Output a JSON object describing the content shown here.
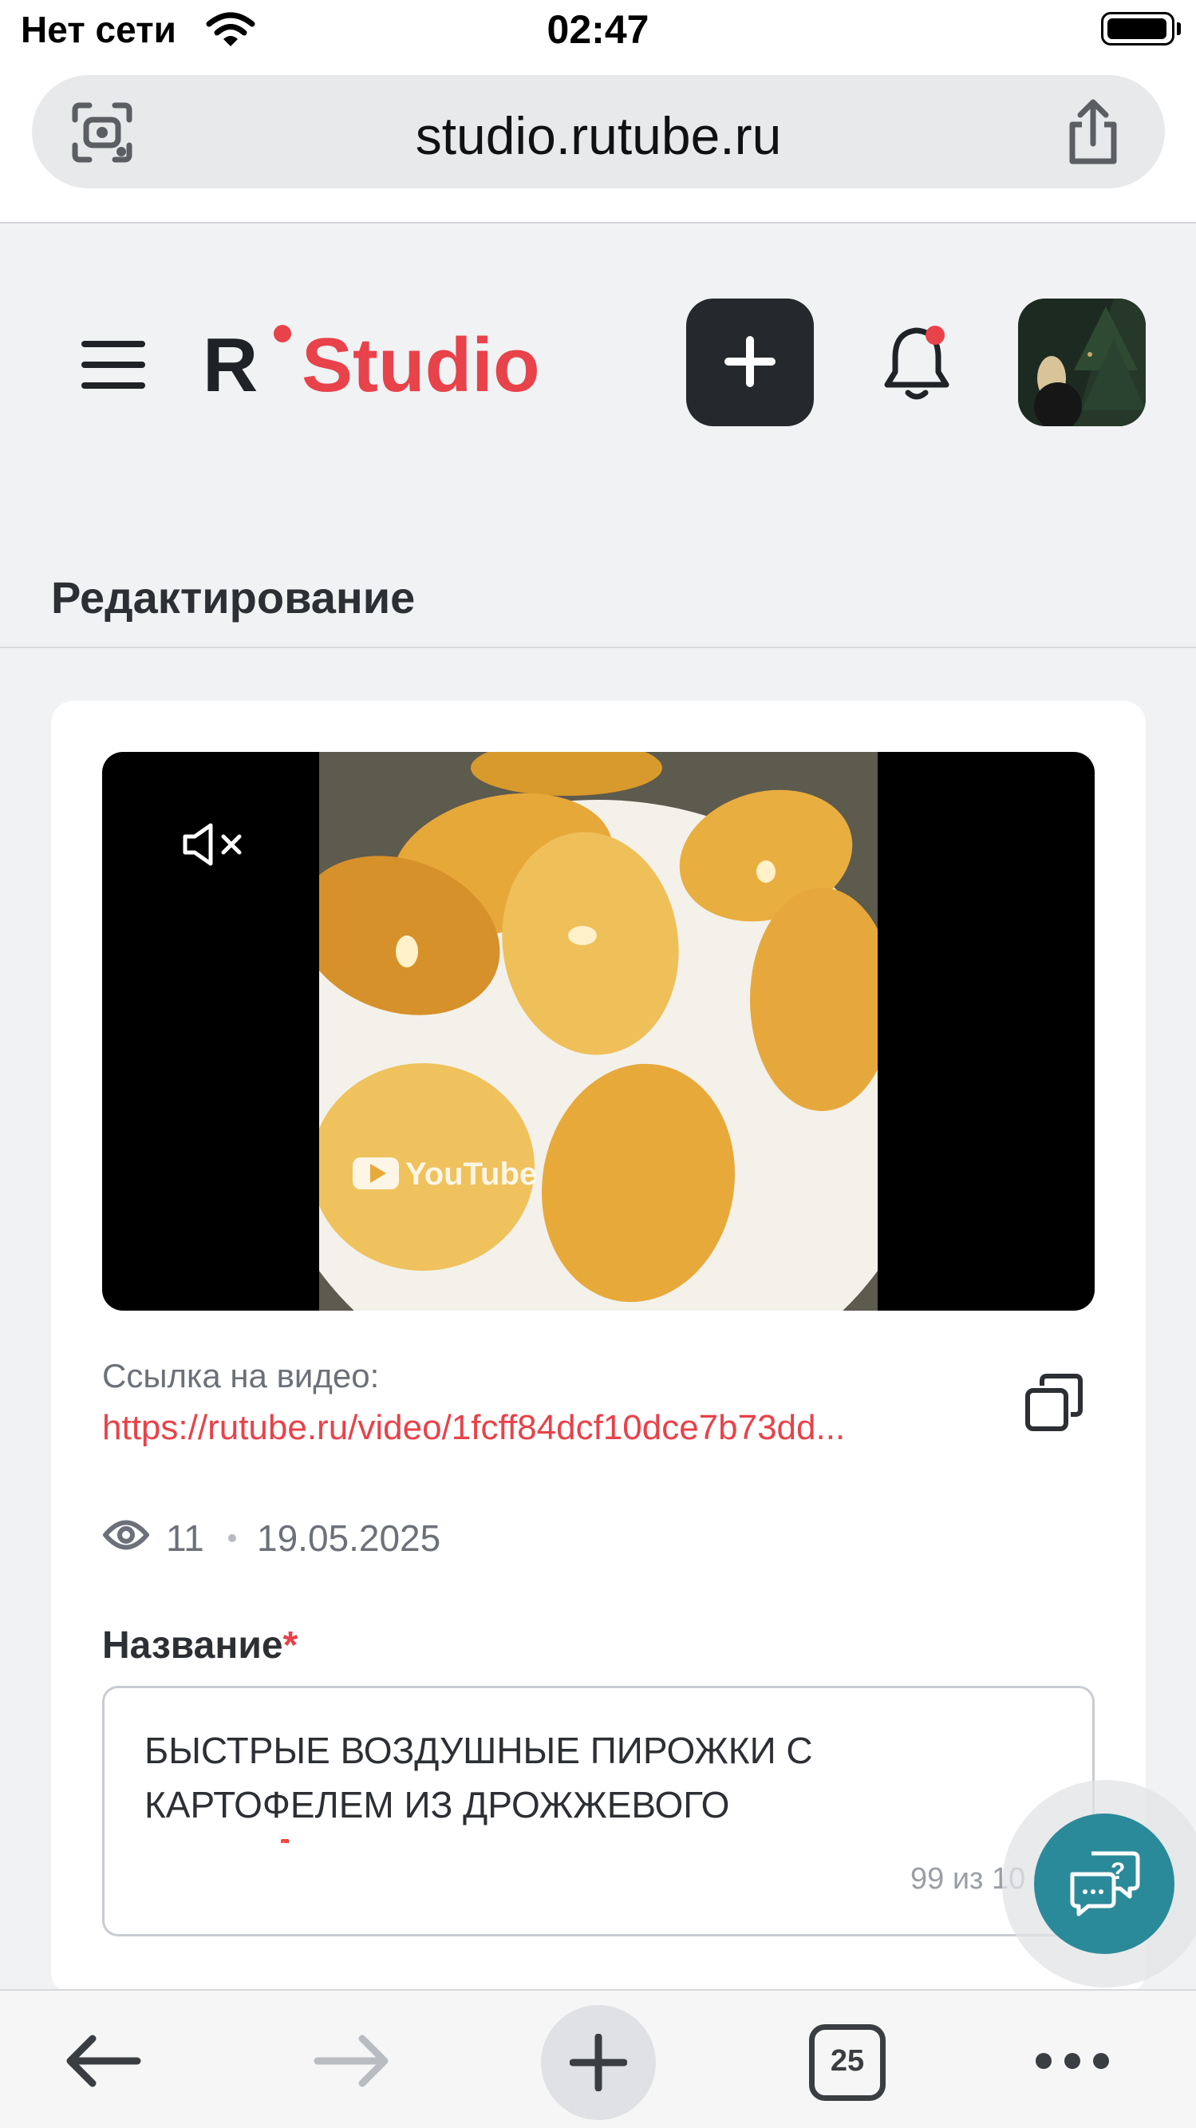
{
  "status_bar": {
    "carrier": "Нет сети",
    "time": "02:47"
  },
  "browser": {
    "url": "studio.rutube.ru"
  },
  "header": {
    "logo_r": "R",
    "logo_studio": "Studio"
  },
  "page": {
    "title": "Редактирование"
  },
  "video": {
    "link_label": "Ссылка на видео:",
    "link_url": "https://rutube.ru/video/1fcff84dcf10dce7b73dd...",
    "views": "11",
    "date": "19.05.2025",
    "watermark": "YouTube"
  },
  "name_field": {
    "label": "Название",
    "required_mark": "*",
    "value": "БЫСТРЫЕ ВОЗДУШНЫЕ ПИРОЖКИ С КАРТОФЕЛЕМ ИЗ ДРОЖЖЕВОГО ТЕСТА❗️НАЧИНКА ГОТОВИТСЯ ДОЛЬШЕ, ЧЕМ",
    "char_count": "99 из 10"
  },
  "toolbar": {
    "tab_count": "25"
  },
  "colors": {
    "brand_red": "#e8424a",
    "dark_button": "#25282c",
    "help_teal": "#2b8a9a"
  }
}
